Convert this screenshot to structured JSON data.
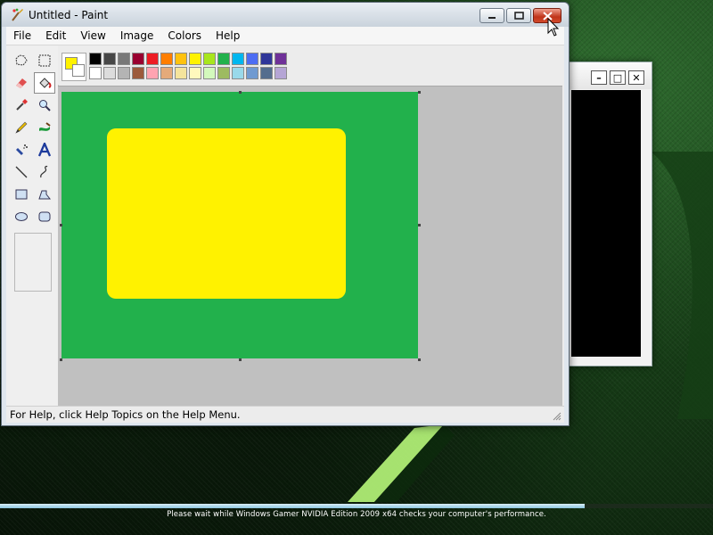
{
  "window": {
    "title": "Untitled - Paint",
    "app_icon": "paint-palette-icon",
    "controls": [
      "minimize-icon",
      "maximize-icon",
      "close-icon"
    ]
  },
  "menu": [
    "File",
    "Edit",
    "View",
    "Image",
    "Colors",
    "Help"
  ],
  "tools": [
    {
      "name": "free-form-select-icon"
    },
    {
      "name": "rect-select-icon"
    },
    {
      "name": "eraser-icon"
    },
    {
      "name": "fill-bucket-icon",
      "selected": true
    },
    {
      "name": "color-picker-icon"
    },
    {
      "name": "magnifier-icon"
    },
    {
      "name": "pencil-icon"
    },
    {
      "name": "brush-icon"
    },
    {
      "name": "airbrush-icon"
    },
    {
      "name": "text-icon"
    },
    {
      "name": "line-icon"
    },
    {
      "name": "curve-icon"
    },
    {
      "name": "rectangle-icon"
    },
    {
      "name": "polygon-icon"
    },
    {
      "name": "ellipse-icon"
    },
    {
      "name": "rounded-rect-icon"
    }
  ],
  "current_colors": {
    "foreground": "#fff200",
    "background": "#ffffff"
  },
  "palette": [
    "#000000",
    "#464646",
    "#787878",
    "#990030",
    "#ed1c24",
    "#ff7e00",
    "#ffc20e",
    "#fff200",
    "#a8e61d",
    "#22b14c",
    "#00b7ef",
    "#4d6df3",
    "#2f3699",
    "#6f3198",
    "#ffffff",
    "#dcdcdc",
    "#b4b4b4",
    "#9c5a3c",
    "#ffa3b1",
    "#e5aa7a",
    "#f5e49c",
    "#fff9bd",
    "#d3f9bc",
    "#9dbb61",
    "#99d9ea",
    "#709ad1",
    "#546d8e",
    "#b5a5d5"
  ],
  "canvas": {
    "background": "#22b14c",
    "shape_fill": "#fff200"
  },
  "status": "For Help, click Help Topics on the Help Menu.",
  "second_window": {
    "controls": [
      "minimize-icon",
      "maximize-icon",
      "close-icon"
    ]
  },
  "progress": {
    "fraction": 0.82
  },
  "bottom_message": "Please wait while Windows Gamer NVIDIA Edition 2009 x64 checks your computer's performance."
}
